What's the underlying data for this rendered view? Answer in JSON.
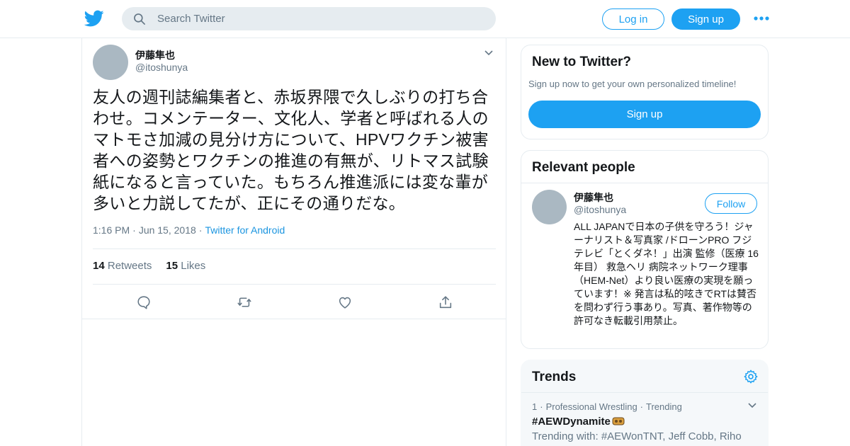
{
  "header": {
    "search_placeholder": "Search Twitter",
    "login_label": "Log in",
    "signup_label": "Sign up",
    "icons": [
      "twitter-bird-icon",
      "search-icon",
      "more-dots-icon"
    ]
  },
  "tweet": {
    "author_name": "伊藤隼也",
    "author_handle": "@itoshunya",
    "text": "友人の週刊誌編集者と、赤坂界隈で久しぶりの打ち合わせ。コメンテーター、文化人、学者と呼ばれる人のマトモさ加減の見分け方について、HPVワクチン被害者への姿勢とワクチンの推進の有無が、リトマス試験紙になると言っていた。もちろん推進派には変な輩が多いと力説してたが、正にその通りだな。",
    "time": "1:16 PM",
    "date": "Jun 15, 2018",
    "via": "Twitter for Android",
    "retweets_count": "14",
    "retweets_label": "Retweets",
    "likes_count": "15",
    "likes_label": "Likes",
    "action_icons": [
      "reply-icon",
      "retweet-icon",
      "like-icon",
      "share-icon"
    ]
  },
  "new_to_twitter": {
    "title": "New to Twitter?",
    "subtitle": "Sign up now to get your own personalized timeline!",
    "button_label": "Sign up"
  },
  "relevant_people": {
    "title": "Relevant people",
    "person": {
      "name": "伊藤隼也",
      "handle": "@itoshunya",
      "follow_label": "Follow",
      "bio": "ALL JAPANで日本の子供を守ろう！ジャーナリスト＆写真家 /ドローンPRO フジテレビ「とくダネ！」出演 監修（医療 16年目） 救急ヘリ 病院ネットワーク理事（HEM-Net）より良い医療の実現を願っています！※ 発言は私的呟きでRTは賛否を問わず行う事あり。写真、著作物等の許可なき転載引用禁止。"
    }
  },
  "trends": {
    "title": "Trends",
    "items": [
      {
        "rank": "1",
        "category": "Professional Wrestling",
        "status": "Trending",
        "name": "#AEWDynamite",
        "trending_with": "Trending with: #AEWonTNT, Jeff Cobb, Riho"
      }
    ]
  },
  "colors": {
    "brand": "#1da1f2",
    "link": "#1b95e0",
    "secondary_text": "#657786",
    "border": "#e6ecf0"
  }
}
